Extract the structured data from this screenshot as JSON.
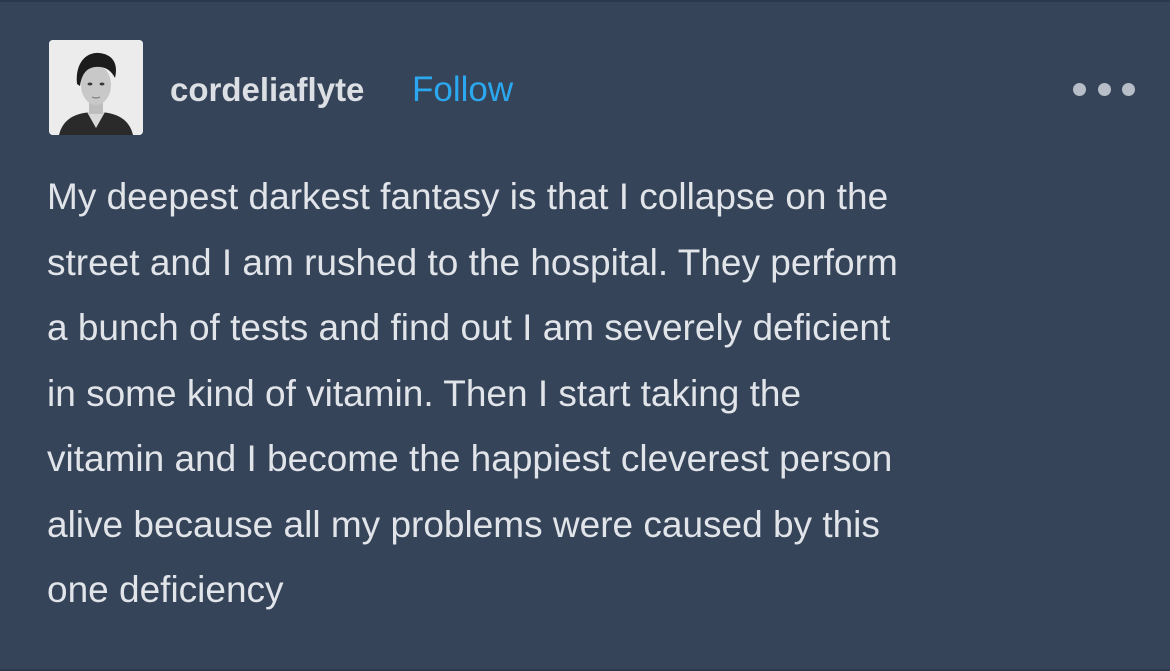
{
  "post": {
    "username": "cordeliaflyte",
    "follow_label": "Follow",
    "more_icon": "ellipsis-icon",
    "avatar_icon": "avatar-portrait",
    "lines": [
      "My deepest darkest fantasy is that I collapse on the",
      "street and I am rushed to the hospital. They perform",
      "a bunch of tests and find out I am severely deficient",
      "in some kind of vitamin. Then I start taking the",
      "vitamin and I become the happiest cleverest person",
      "alive because all my problems were caused by this",
      "one deficiency"
    ]
  },
  "colors": {
    "background": "#354459",
    "username": "#dcdfe4",
    "follow": "#2ba8ef",
    "text": "#e1e4e9"
  }
}
